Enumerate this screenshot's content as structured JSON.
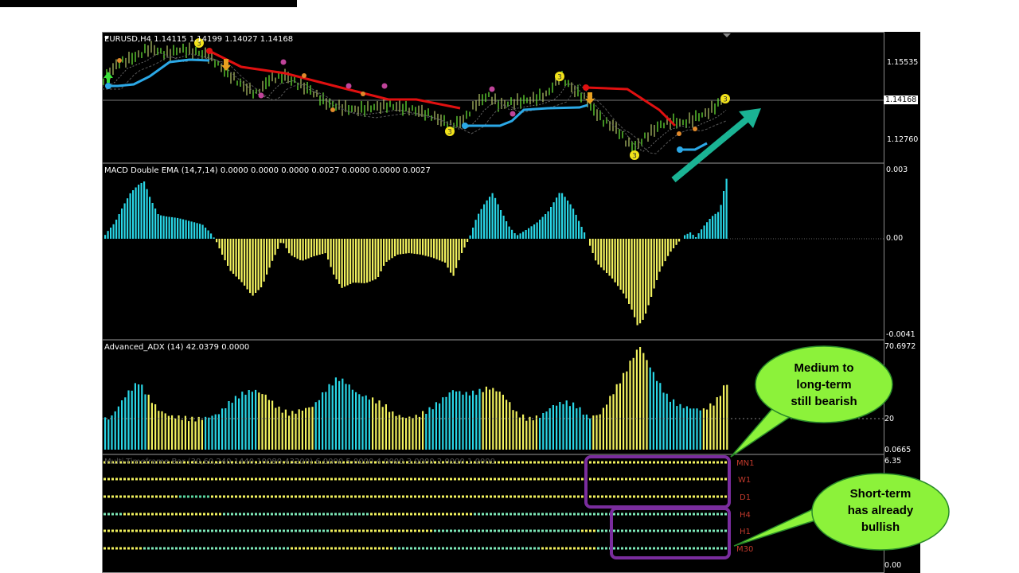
{
  "window": {
    "symbol_header": "EURUSD,H4  1.14115 1.14199 1.14027 1.14168",
    "current_price": "1.14168"
  },
  "panels": {
    "price": {
      "axis_ticks": [
        "1.15535",
        "1.12760"
      ]
    },
    "macd": {
      "title": "MACD Double EMA (14,7,14) 0.0000 0.0000 0.0000 0.0027 0.0000 0.0000 0.0027",
      "axis_ticks": [
        "0.003",
        "0.00",
        "-0.0041"
      ]
    },
    "adx": {
      "title": "Advanced_ADX (14) 42.0379 0.0000",
      "axis_ticks": [
        "70.6972",
        "20",
        "0.0665"
      ]
    },
    "mtf": {
      "title": "Multi-Timeframe Bar (30,60,240,1440,10080,43200) 6.0000 5.0000 4.0000 3.0000 2.0000 1.0000",
      "axis_ticks": [
        "6.35",
        "0.00"
      ],
      "timeframes": [
        "MN1",
        "W1",
        "D1",
        "H4",
        "H1",
        "M30"
      ]
    }
  },
  "callouts": {
    "medium": [
      "Medium to",
      "long-term",
      "still bearish"
    ],
    "short": [
      "Short-term",
      "has already",
      "bullish"
    ]
  },
  "colors": {
    "bull": "#29d6e6",
    "bear": "#f2f25e",
    "resistance": "#e01010",
    "support": "#2ba8e6",
    "arrow": "#1ab394",
    "callout_fill": "#8cf23a",
    "frame": "#7a2d9e"
  }
}
